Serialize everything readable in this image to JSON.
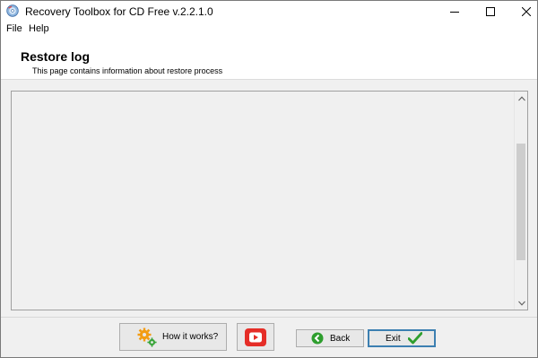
{
  "window": {
    "title": "Recovery Toolbox for CD Free v.2.2.1.0"
  },
  "menu": {
    "items": [
      {
        "label": "File"
      },
      {
        "label": "Help"
      }
    ]
  },
  "header": {
    "title": "Restore log",
    "subtitle": "This page contains information about restore process"
  },
  "log": {
    "content": ""
  },
  "buttons": {
    "how_it_works": "How it works?",
    "back": "Back",
    "exit": "Exit"
  },
  "icons": {
    "app": "recovery-cd-icon",
    "how_it_works": "gears-icon",
    "video": "youtube-play-icon",
    "back": "back-arrow-icon",
    "exit": "checkmark-icon"
  },
  "colors": {
    "video_button": "#e52d27",
    "back_icon": "#2e9e2e",
    "exit_check": "#2e9e2e",
    "gear_orange": "#f39c12",
    "gear_green": "#3aa53a"
  }
}
